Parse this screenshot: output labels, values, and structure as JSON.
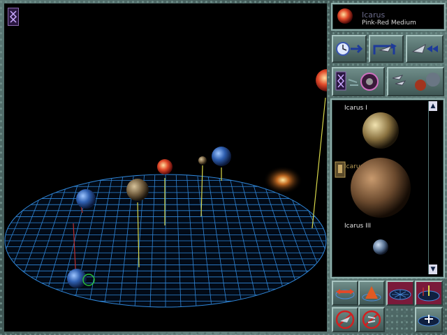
{
  "star": {
    "name": "Icarus",
    "type": "Pink-Red Medium"
  },
  "planets": [
    {
      "name": "Icarus I"
    },
    {
      "name": "Icarus II"
    },
    {
      "name": "Icarus III"
    }
  ],
  "scroll": {
    "up": "▲",
    "down": "▼"
  },
  "colors": {
    "grid": "#2f86d8",
    "stem_yellow": "#d8d84a",
    "stem_red": "#c03030",
    "selection": "#28c23a"
  },
  "icons": {
    "corner": "galaxy-map-icon",
    "toolbar_row1": [
      "time-forward-icon",
      "fleet-transfer-icon",
      "fleet-move-icon"
    ],
    "toolbar_row2": [
      "galaxy-fleet-icon",
      "fleet-planets-icon"
    ],
    "bottom_row1": [
      "zoom-arrows-icon",
      "camera-view-icon",
      "grid-icon",
      "grid-marker-icon"
    ],
    "bottom_row2": [
      "no-fleet-icon",
      "no-ships-icon",
      "grid-add-icon"
    ]
  }
}
